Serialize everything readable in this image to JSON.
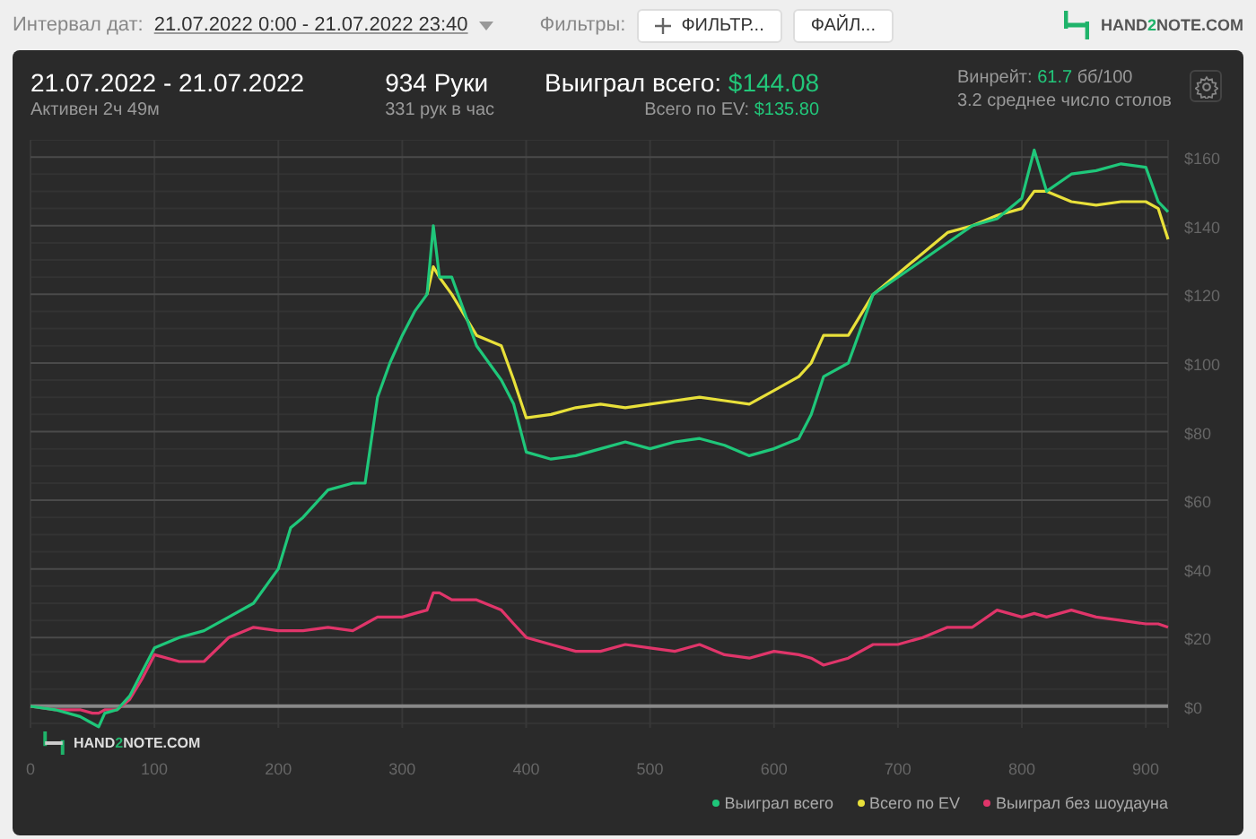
{
  "toolbar": {
    "interval_label": "Интервал дат:",
    "interval_value": "21.07.2022 0:00 - 21.07.2022 23:40",
    "filters_label": "Фильтры:",
    "filter_button": "ФИЛЬТР...",
    "file_button": "ФАЙЛ...",
    "logo": [
      "HAND",
      "2",
      "NOTE.COM"
    ]
  },
  "summary": {
    "date_range": "21.07.2022 - 21.07.2022",
    "active": "Активен 2ч 49м",
    "hands": "934 Руки",
    "hands_per_hour": "331 рук в час",
    "won_label": "Выиграл всего:",
    "won_value": "$144.08",
    "ev_label": "Всего по EV:",
    "ev_value": "$135.80",
    "winrate_label": "Винрейт:",
    "winrate_value": "61.7",
    "winrate_unit": "бб/100",
    "tables": "3.2 среднее число столов"
  },
  "chart": {
    "watermark": [
      "HAND",
      "2",
      "NOTE.COM"
    ],
    "chart_data": {
      "type": "line",
      "x": [
        0,
        20,
        40,
        50,
        55,
        60,
        70,
        80,
        90,
        100,
        120,
        140,
        160,
        180,
        200,
        210,
        220,
        240,
        260,
        270,
        280,
        290,
        300,
        310,
        320,
        325,
        330,
        340,
        360,
        380,
        390,
        400,
        420,
        440,
        460,
        480,
        500,
        520,
        540,
        560,
        580,
        600,
        620,
        630,
        640,
        660,
        680,
        700,
        720,
        740,
        760,
        780,
        800,
        810,
        820,
        840,
        860,
        880,
        900,
        910,
        918
      ],
      "series": [
        {
          "name": "Выиграл всего",
          "color": "#1fc77a",
          "values": [
            0,
            -1,
            -3,
            -5,
            -6,
            -2,
            -1,
            3,
            10,
            17,
            20,
            22,
            26,
            30,
            40,
            52,
            55,
            63,
            65,
            65,
            90,
            100,
            108,
            115,
            120,
            140,
            125,
            125,
            105,
            95,
            88,
            74,
            72,
            73,
            75,
            77,
            75,
            77,
            78,
            76,
            73,
            75,
            78,
            85,
            96,
            100,
            120,
            125,
            130,
            135,
            140,
            142,
            148,
            162,
            150,
            155,
            156,
            158,
            157,
            147,
            144
          ]
        },
        {
          "name": "Всего по EV",
          "color": "#e8e03a",
          "values": [
            null,
            null,
            null,
            null,
            null,
            null,
            null,
            null,
            null,
            null,
            null,
            null,
            null,
            null,
            null,
            null,
            null,
            null,
            null,
            null,
            null,
            null,
            null,
            null,
            120,
            128,
            125,
            120,
            108,
            105,
            95,
            84,
            85,
            87,
            88,
            87,
            88,
            89,
            90,
            89,
            88,
            92,
            96,
            100,
            108,
            108,
            120,
            126,
            132,
            138,
            140,
            143,
            145,
            150,
            150,
            147,
            146,
            147,
            147,
            145,
            136
          ]
        },
        {
          "name": "Выиграл без шоудауна",
          "color": "#e0356a",
          "values": [
            0,
            -1,
            -1,
            -2,
            -2,
            -1,
            -1,
            2,
            8,
            15,
            13,
            13,
            20,
            23,
            22,
            22,
            22,
            23,
            22,
            24,
            26,
            26,
            26,
            27,
            28,
            33,
            33,
            31,
            31,
            28,
            24,
            20,
            18,
            16,
            16,
            18,
            17,
            16,
            18,
            15,
            14,
            16,
            15,
            14,
            12,
            14,
            18,
            18,
            20,
            23,
            23,
            28,
            26,
            27,
            26,
            28,
            26,
            25,
            24,
            24,
            23
          ]
        }
      ],
      "grid": true,
      "xlim": [
        0,
        918
      ],
      "ylim": [
        -6.3,
        165
      ],
      "xticks": [
        0,
        100,
        200,
        300,
        400,
        500,
        600,
        700,
        800,
        900
      ],
      "yticks": [
        {
          "value": 0,
          "label": "$0"
        },
        {
          "value": 20,
          "label": "$20"
        },
        {
          "value": 40,
          "label": "$40"
        },
        {
          "value": 60,
          "label": "$60"
        },
        {
          "value": 80,
          "label": "$80"
        },
        {
          "value": 100,
          "label": "$100"
        },
        {
          "value": 120,
          "label": "$120"
        },
        {
          "value": 140,
          "label": "$140"
        },
        {
          "value": 160,
          "label": "$160"
        }
      ]
    }
  }
}
